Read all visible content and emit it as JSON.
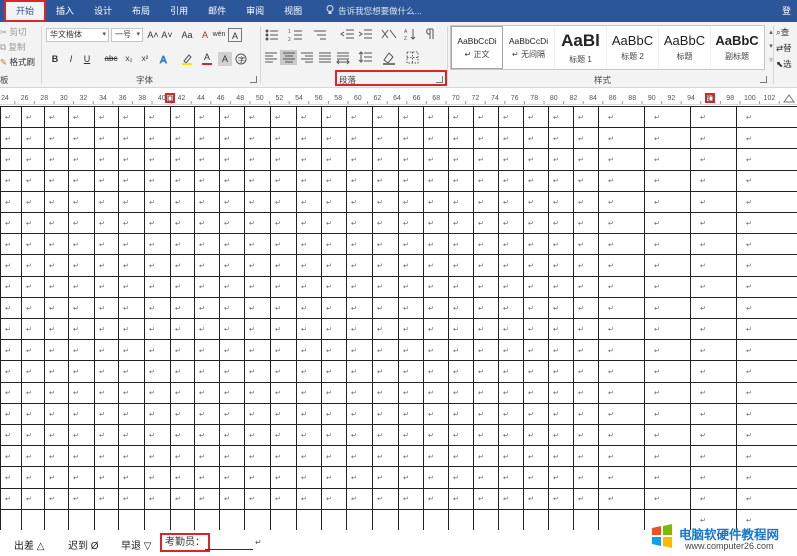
{
  "tabs": [
    {
      "label": "开始",
      "active": true
    },
    {
      "label": "插入"
    },
    {
      "label": "设计"
    },
    {
      "label": "布局"
    },
    {
      "label": "引用"
    },
    {
      "label": "邮件"
    },
    {
      "label": "审阅"
    },
    {
      "label": "视图"
    }
  ],
  "tell_me": "告诉我您想要做什么...",
  "login": "登",
  "clipboard": {
    "cut": "剪切",
    "copy": "复制",
    "format_painter": "格式刷",
    "group": "板"
  },
  "font": {
    "family": "华文楷体",
    "size": "一号",
    "group": "字体",
    "bold": "B",
    "italic": "I",
    "underline": "U",
    "strike": "abc",
    "subscript": "x₂",
    "superscript": "x²",
    "grow": "A˄",
    "shrink": "A˅",
    "case": "Aa",
    "color_a": "A",
    "wen": "wén",
    "char_a": "A",
    "clear": "A"
  },
  "paragraph": {
    "group": "段落"
  },
  "styles": {
    "group": "样式",
    "items": [
      {
        "sample": "AaBbCcDi",
        "name": "↵ 正文"
      },
      {
        "sample": "AaBbCcDi",
        "name": "↵ 无间隔"
      },
      {
        "sample": "AaBl",
        "name": "标题 1"
      },
      {
        "sample": "AaBbC",
        "name": "标题 2"
      },
      {
        "sample": "AaBbC",
        "name": "标题"
      },
      {
        "sample": "AaBbC",
        "name": "副标题"
      }
    ]
  },
  "editing": {
    "find": "查",
    "replace": "替",
    "select": "选"
  },
  "ruler": {
    "labels": [
      "24",
      "26",
      "28",
      "30",
      "32",
      "34",
      "36",
      "38",
      "40",
      "42",
      "44",
      "46",
      "48",
      "50",
      "52",
      "54",
      "56",
      "58",
      "60",
      "62",
      "64",
      "66",
      "68",
      "70",
      "72",
      "74",
      "76",
      "78",
      "80",
      "82",
      "84",
      "86",
      "88",
      "90",
      "92",
      "94",
      "96",
      "98",
      "100",
      "102"
    ]
  },
  "table": {
    "para_mark": "↵",
    "rows": 20,
    "cols": 34
  },
  "legend": {
    "business_trip": "出差 △",
    "late": "迟到 Ø",
    "early_leave": "早退 ▽",
    "inspector": "考勤员：",
    "end_mark": "↵"
  },
  "watermark": {
    "title": "电脑软硬件教程网",
    "url": "www.computer26.com"
  },
  "colors": {
    "accent": "#2b579a",
    "highlight_box": "#d9262c"
  }
}
